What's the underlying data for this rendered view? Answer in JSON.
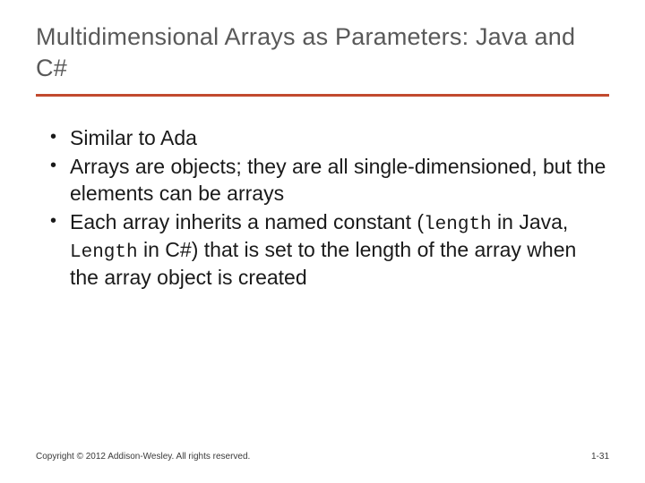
{
  "title": "Multidimensional Arrays as Parameters: Java and C#",
  "bullets": [
    {
      "text": "Similar to Ada"
    },
    {
      "text": "Arrays are objects; they are all single-dimensioned, but the elements can be arrays"
    },
    {
      "pre": "Each array inherits a named constant (",
      "code1": "length",
      "mid": " in Java, ",
      "code2": "Length",
      "post": " in C#) that is set to the length of the array when the array object is created"
    }
  ],
  "footer": "Copyright © 2012 Addison-Wesley. All rights reserved.",
  "pagenum": "1-31",
  "colors": {
    "rule": "#c24a2e",
    "title": "#595959"
  }
}
